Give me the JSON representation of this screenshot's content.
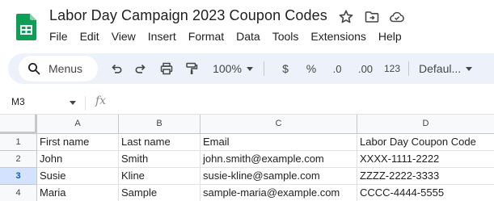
{
  "document": {
    "title": "Labor Day Campaign 2023 Coupon Codes"
  },
  "menu": [
    "File",
    "Edit",
    "View",
    "Insert",
    "Format",
    "Data",
    "Tools",
    "Extensions",
    "Help"
  ],
  "toolbar": {
    "search_label": "Menus",
    "zoom": "100%",
    "currency": "$",
    "percent": "%",
    "decrease_decimal": ".0",
    "increase_decimal": ".00",
    "number_format": "123",
    "font": "Defaul..."
  },
  "formula_bar": {
    "cell_ref": "M3",
    "fx_label": "fx",
    "formula": ""
  },
  "sheet": {
    "columns": [
      "A",
      "B",
      "C",
      "D"
    ],
    "rows": [
      {
        "num": "1",
        "cells": [
          "First name",
          "Last name",
          "Email",
          "Labor Day Coupon Code"
        ]
      },
      {
        "num": "2",
        "cells": [
          "John",
          "Smith",
          "john.smith@example.com",
          "XXXX-1111-2222"
        ]
      },
      {
        "num": "3",
        "cells": [
          "Susie",
          "Kline",
          "susie-kline@sample.com",
          "ZZZZ-2222-3333"
        ]
      },
      {
        "num": "4",
        "cells": [
          "Maria",
          "Sample",
          "sample-maria@example.com",
          "CCCC-4444-5555"
        ]
      }
    ],
    "selected_row": "3"
  },
  "colors": {
    "brand_green": "#0f9d58",
    "toolbar_bg": "#edf2fa",
    "selected_row_bg": "#d3e3fd",
    "selected_row_text": "#0b57d0"
  }
}
